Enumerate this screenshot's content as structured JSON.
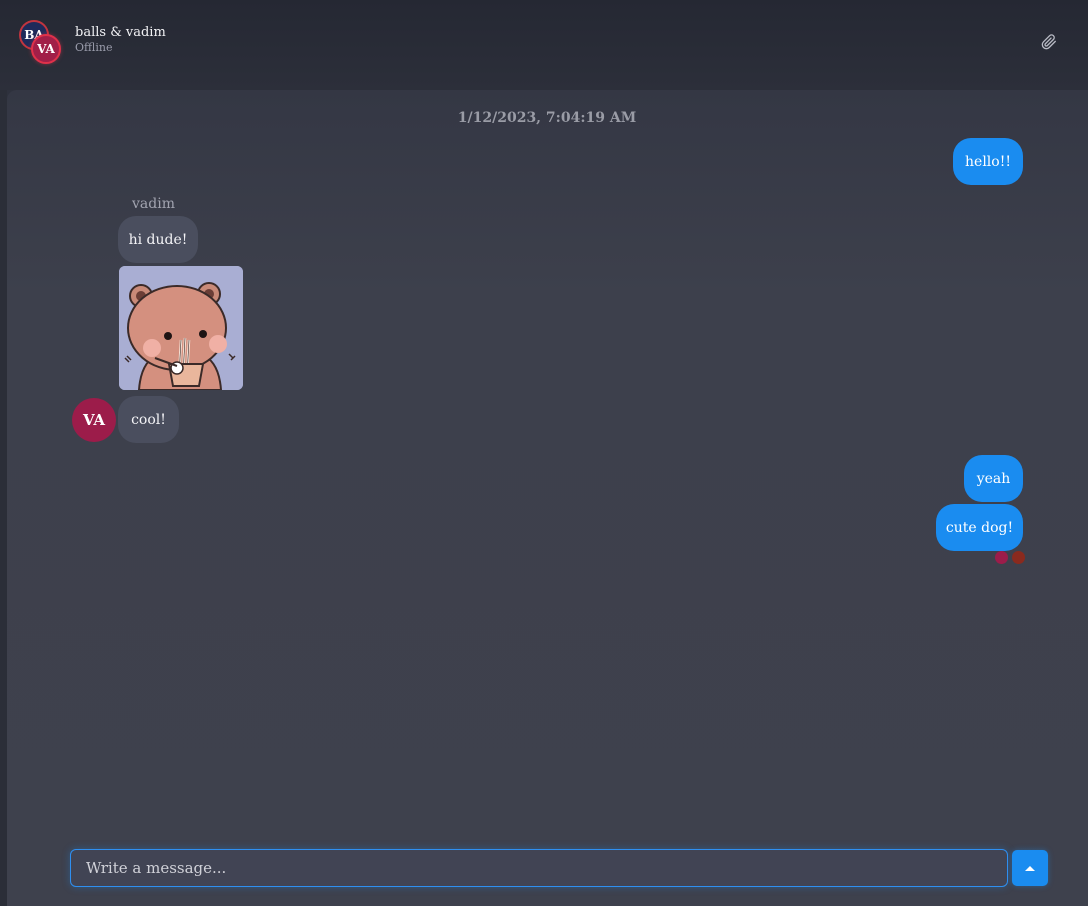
{
  "header": {
    "avatars": [
      "BA",
      "VA"
    ],
    "chat_name": "balls & vadim",
    "status": "Offline"
  },
  "messages": {
    "timestamp": "1/12/2023, 7:04:19 AM",
    "out_1": "hello!!",
    "sender": "vadim",
    "in_1": "hi dude!",
    "in_2": "cool!",
    "in_avatar": "VA",
    "out_2": "yeah",
    "out_3": "cute dog!"
  },
  "composer": {
    "placeholder": "Write a message..."
  },
  "colors": {
    "accent": "#1a8cf0",
    "incoming_bubble": "#4a4e5e",
    "avatar_va": "#9c1c4a",
    "read_dot_1": "#9c1c4a",
    "read_dot_2": "#8a2a1e"
  }
}
